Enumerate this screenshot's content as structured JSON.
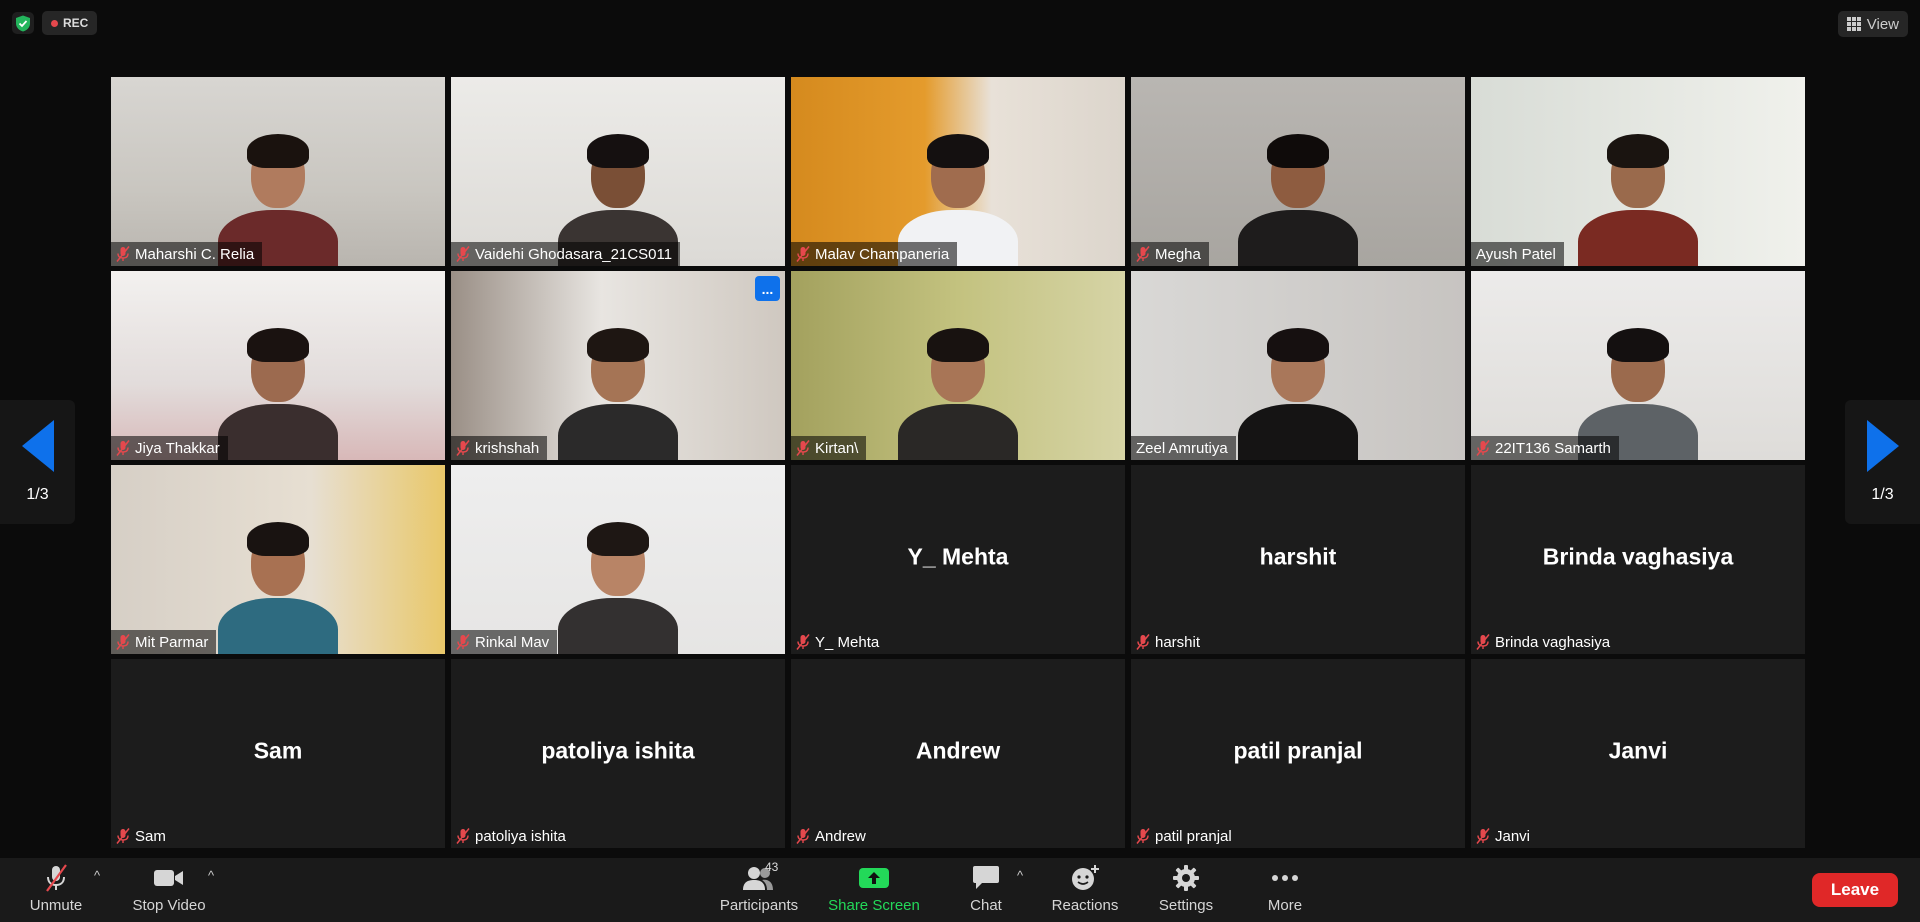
{
  "meeting": {
    "recording_label": "REC",
    "view_label": "View",
    "page_indicator": "1/3"
  },
  "participants": [
    {
      "name": "Maharshi C. Relia",
      "muted": true,
      "video": true
    },
    {
      "name": "Vaidehi Ghodasara_21CS011",
      "muted": true,
      "video": true
    },
    {
      "name": "Malav Champaneria",
      "muted": true,
      "video": true
    },
    {
      "name": "Megha",
      "muted": true,
      "video": true
    },
    {
      "name": "Ayush Patel",
      "muted": false,
      "video": true
    },
    {
      "name": "Jiya Thakkar",
      "muted": true,
      "video": true
    },
    {
      "name": "krishshah",
      "muted": true,
      "video": true,
      "more_label": "..."
    },
    {
      "name": "Kirtan\\",
      "muted": true,
      "video": true
    },
    {
      "name": "Zeel Amrutiya",
      "muted": false,
      "video": true,
      "active_speaker": true
    },
    {
      "name": "22IT136 Samarth",
      "muted": true,
      "video": true
    },
    {
      "name": "Mit Parmar",
      "muted": true,
      "video": true
    },
    {
      "name": "Rinkal Mav",
      "muted": true,
      "video": true
    },
    {
      "name": "Y_ Mehta",
      "muted": true,
      "video": false
    },
    {
      "name": "harshit",
      "muted": true,
      "video": false
    },
    {
      "name": "Brinda vaghasiya",
      "muted": true,
      "video": false
    },
    {
      "name": "Sam",
      "muted": true,
      "video": false
    },
    {
      "name": "patoliya ishita",
      "muted": true,
      "video": false
    },
    {
      "name": "Andrew",
      "muted": true,
      "video": false
    },
    {
      "name": "patil pranjal",
      "muted": true,
      "video": false
    },
    {
      "name": "Janvi",
      "muted": true,
      "video": false
    }
  ],
  "toolbar": {
    "unmute": "Unmute",
    "stop_video": "Stop Video",
    "participants": "Participants",
    "participant_count": "43",
    "share_screen": "Share Screen",
    "chat": "Chat",
    "reactions": "Reactions",
    "settings": "Settings",
    "more": "More",
    "leave": "Leave"
  },
  "colors": {
    "active_speaker_border": "#c7dd5c",
    "share_screen_green": "#23d959",
    "leave_red": "#e02828",
    "pager_arrow_blue": "#0e71eb",
    "mute_red": "#e5484d"
  }
}
